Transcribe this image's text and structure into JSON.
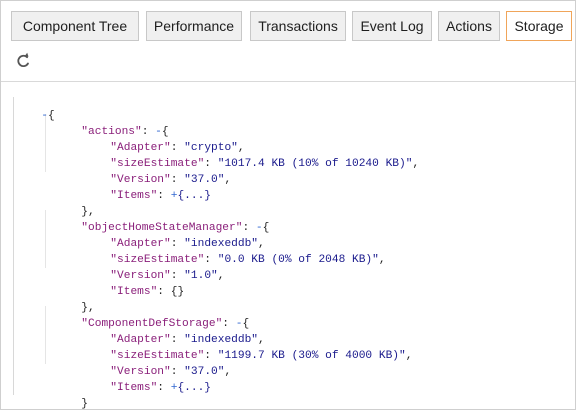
{
  "tabs": [
    {
      "label": "Component Tree",
      "active": false
    },
    {
      "label": "Performance",
      "active": false
    },
    {
      "label": "Transactions",
      "active": false
    },
    {
      "label": "Event Log",
      "active": false
    },
    {
      "label": "Actions",
      "active": false
    },
    {
      "label": "Storage",
      "active": true
    }
  ],
  "toolbar": {
    "refresh_icon": "refresh-icon"
  },
  "json": {
    "root_toggle": "-",
    "root_open": "{",
    "root_close": "}",
    "stores": [
      {
        "key": "\"actions\"",
        "toggle": "-",
        "items_toggle": "+",
        "items_value": "{...}",
        "fields": [
          {
            "key": "\"Adapter\"",
            "value": "\"crypto\""
          },
          {
            "key": "\"sizeEstimate\"",
            "value": "\"1017.4 KB (10% of 10240 KB)\""
          },
          {
            "key": "\"Version\"",
            "value": "\"37.0\""
          }
        ]
      },
      {
        "key": "\"objectHomeStateManager\"",
        "toggle": "-",
        "items_toggle": "",
        "items_value": "{}",
        "fields": [
          {
            "key": "\"Adapter\"",
            "value": "\"indexeddb\""
          },
          {
            "key": "\"sizeEstimate\"",
            "value": "\"0.0 KB (0% of 2048 KB)\""
          },
          {
            "key": "\"Version\"",
            "value": "\"1.0\""
          }
        ]
      },
      {
        "key": "\"ComponentDefStorage\"",
        "toggle": "-",
        "items_toggle": "+",
        "items_value": "{...}",
        "fields": [
          {
            "key": "\"Adapter\"",
            "value": "\"indexeddb\""
          },
          {
            "key": "\"sizeEstimate\"",
            "value": "\"1199.7 KB (30% of 4000 KB)\""
          },
          {
            "key": "\"Version\"",
            "value": "\"37.0\""
          }
        ]
      }
    ],
    "items_key": "\"Items\""
  }
}
